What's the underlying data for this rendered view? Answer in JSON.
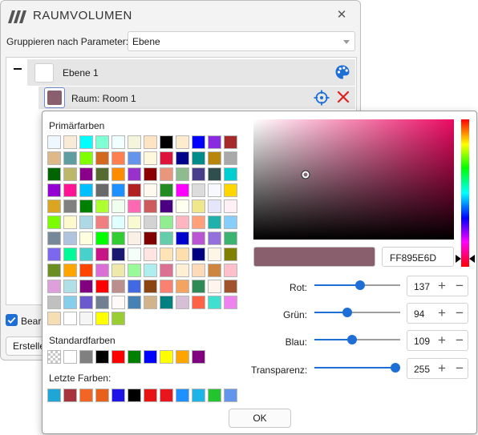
{
  "window": {
    "title": "RAUMVOLUMEN",
    "close_glyph": "✕",
    "group_label": "Gruppieren nach Parameter:",
    "group_value": "Ebene",
    "tree": {
      "level_row": {
        "label": "Ebene 1",
        "swatch_color": "#ffffff"
      },
      "room_row": {
        "label": "Raum: Room 1",
        "swatch_color": "#895e6d"
      }
    },
    "checkbox_label": "Bearbeiten",
    "create_button_label": "Erstellen",
    "icons": {
      "logo": "logo-icon",
      "palette": "palette-icon",
      "target": "crosshair-icon",
      "delete": "delete-icon"
    },
    "colors": {
      "accent": "#1d6fd6",
      "danger": "#e02020"
    }
  },
  "picker": {
    "primary_label": "Primärfarben",
    "primary_colors": [
      "#f0f8ff",
      "#faebd7",
      "#00ffff",
      "#7fffd4",
      "#f0ffff",
      "#f5f5dc",
      "#ffe4c4",
      "#000000",
      "#ffebcd",
      "#0000ff",
      "#8a2be2",
      "#a52a2a",
      "#deb887",
      "#5f9ea0",
      "#7fff00",
      "#d2691e",
      "#ff7f50",
      "#6495ed",
      "#fff8dc",
      "#dc143c",
      "#00008b",
      "#008b8b",
      "#b8860b",
      "#a9a9a9",
      "#006400",
      "#bdb76b",
      "#8b008b",
      "#556b2f",
      "#ff8c00",
      "#9932cc",
      "#8b0000",
      "#e9967a",
      "#8fbc8f",
      "#483d8b",
      "#2f4f4f",
      "#00ced1",
      "#9400d3",
      "#ff1493",
      "#00bfff",
      "#696969",
      "#1e90ff",
      "#b22222",
      "#fffaf0",
      "#228b22",
      "#ff00ff",
      "#dcdcdc",
      "#f8f8ff",
      "#ffd700",
      "#daa520",
      "#808080",
      "#008000",
      "#adff2f",
      "#f0fff0",
      "#ff69b4",
      "#cd5c5c",
      "#4b0082",
      "#fffff0",
      "#f0e68c",
      "#e6e6fa",
      "#fff0f5",
      "#7cfc00",
      "#fffacd",
      "#add8e6",
      "#f08080",
      "#e0ffff",
      "#fafad2",
      "#d3d3d3",
      "#90ee90",
      "#ffb6c1",
      "#ffa07a",
      "#20b2aa",
      "#87cefa",
      "#778899",
      "#b0c4de",
      "#ffffe0",
      "#00ff00",
      "#32cd32",
      "#faf0e6",
      "#800000",
      "#66cdaa",
      "#0000cd",
      "#ba55d3",
      "#9370db",
      "#3cb371",
      "#7b68ee",
      "#00fa9a",
      "#48d1cc",
      "#c71585",
      "#191970",
      "#f5fffa",
      "#ffe4e1",
      "#ffe4b5",
      "#ffdead",
      "#000080",
      "#fdf5e6",
      "#808000",
      "#6b8e23",
      "#ffa500",
      "#ff4500",
      "#da70d6",
      "#eee8aa",
      "#98fb98",
      "#afeeee",
      "#db7093",
      "#ffefd5",
      "#ffdab9",
      "#cd853f",
      "#ffc0cb",
      "#dda0dd",
      "#b0e0e6",
      "#800080",
      "#ff0000",
      "#bc8f8f",
      "#4169e1",
      "#8b4513",
      "#fa8072",
      "#f4a460",
      "#2e8b57",
      "#fff5ee",
      "#a0522d",
      "#c0c0c0",
      "#87ceeb",
      "#6a5acd",
      "#708090",
      "#fffafa",
      "#4682b4",
      "#d2b48c",
      "#008080",
      "#d8bfd8",
      "#ff6347",
      "#40e0d0",
      "#ee82ee",
      "#f5deb3",
      "#ffffff",
      "#f5f5f5",
      "#ffff00",
      "#9acd32"
    ],
    "standard_label": "Standardfarben",
    "standard_colors": [
      "transparent",
      "#ffffff",
      "#808080",
      "#000000",
      "#ff0000",
      "#008000",
      "#0000ff",
      "#ffff00",
      "#ffa500",
      "#800080"
    ],
    "recent_label": "Letzte Farben:",
    "recent_colors": [
      "#1ea7d6",
      "#a8323e",
      "#f26522",
      "#e8601a",
      "#1e14e8",
      "#000000",
      "#e81414",
      "#e8141e",
      "#1e90ff",
      "#1eb4e8",
      "#22c52e",
      "#6495ed"
    ],
    "hex_value": "FF895E6D",
    "current_color": "#895e6d",
    "sv_handle_level": {
      "saturation": 0.26,
      "value": 0.54
    },
    "sliders": [
      {
        "label": "Rot:",
        "value": "137",
        "level": 137
      },
      {
        "label": "Grün:",
        "value": "94",
        "level": 94
      },
      {
        "label": "Blau:",
        "value": "109",
        "level": 109
      },
      {
        "label": "Transparenz:",
        "value": "255",
        "level": 255
      }
    ],
    "plus_glyph": "+",
    "minus_glyph": "−",
    "ok_label": "OK"
  }
}
